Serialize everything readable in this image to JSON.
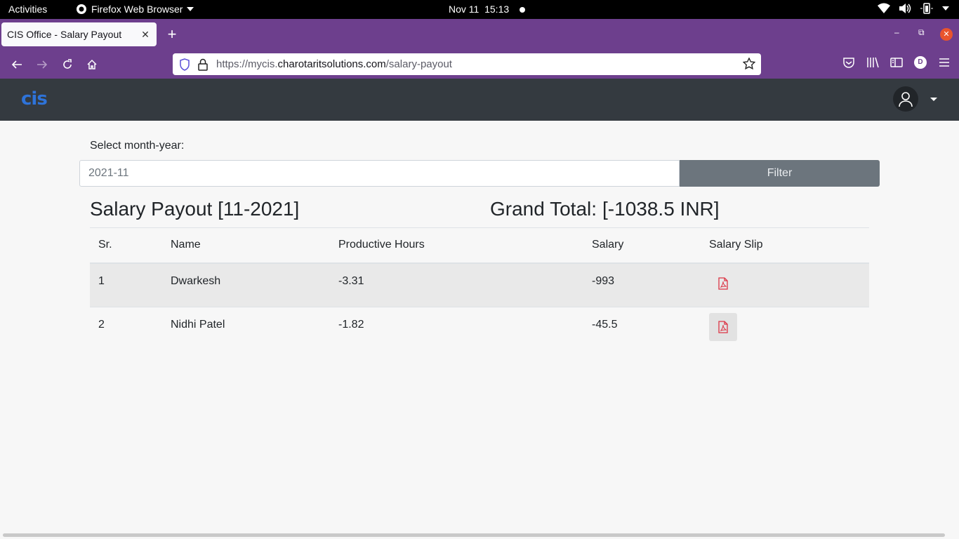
{
  "system_bar": {
    "activities": "Activities",
    "app_name": "Firefox Web Browser",
    "date": "Nov 11",
    "time": "15:13"
  },
  "browser": {
    "tab_title": "CIS Office - Salary Payout",
    "url_prefix": "https://mycis.",
    "url_domain": "charotaritsolutions.com",
    "url_path": "/salary-payout",
    "profile_initial": "D"
  },
  "app": {
    "logo": "cis"
  },
  "filter": {
    "label": "Select month-year:",
    "value": "2021-11",
    "button": "Filter"
  },
  "summary": {
    "title": "Salary Payout [11-2021]",
    "grand_total_label": "Grand Total:",
    "grand_total_value": "[-1038.5 INR]"
  },
  "table": {
    "headers": [
      "Sr.",
      "Name",
      "Productive Hours",
      "Salary",
      "Salary Slip"
    ],
    "rows": [
      {
        "sr": "1",
        "name": "Dwarkesh",
        "hours": "-3.31",
        "salary": "-993"
      },
      {
        "sr": "2",
        "name": "Nidhi Patel",
        "hours": "-1.82",
        "salary": "-45.5"
      }
    ]
  },
  "colors": {
    "browser_chrome": "#6d3f8d",
    "app_header": "#343a40",
    "filter_button": "#6c757d",
    "pdf_icon": "#dc3545"
  }
}
